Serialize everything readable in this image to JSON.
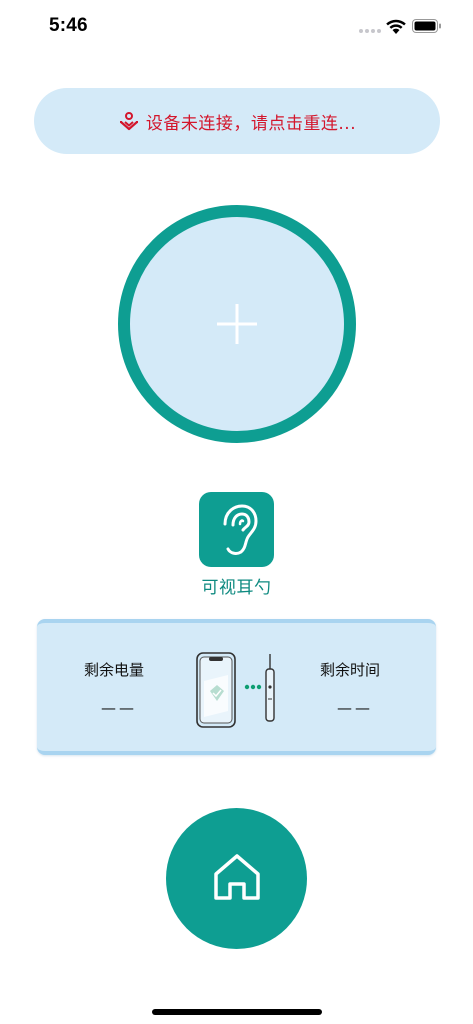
{
  "status_bar": {
    "time": "5:46"
  },
  "banner": {
    "text": "设备未连接，请点击重连...",
    "icon": "disconnected-device-icon",
    "text_color": "#d3162c",
    "background": "#d4eaf8"
  },
  "add_device": {
    "icon": "plus-icon",
    "ring_color": "#0e9e92"
  },
  "device": {
    "icon": "ear-icon",
    "name": "可视耳勺"
  },
  "info_card": {
    "battery_label": "剩余电量",
    "battery_value": "——",
    "time_label": "剩余时间",
    "time_value": "——"
  },
  "home_button": {
    "icon": "home-icon"
  },
  "colors": {
    "accent": "#0e9e92",
    "panel": "#d4eaf8"
  }
}
